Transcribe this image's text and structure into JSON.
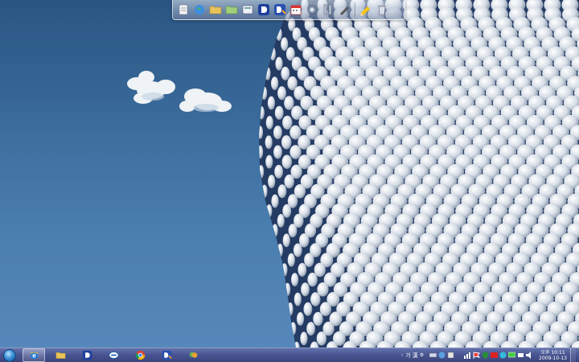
{
  "desktop": {
    "wallpaper": "selfridges-building-facade",
    "sky_color": "#3b6c9c",
    "disc_color": "#e8ecf2"
  },
  "dock": {
    "items": [
      {
        "icon": "notepad-icon"
      },
      {
        "icon": "globe-icon"
      },
      {
        "icon": "folder-icon"
      },
      {
        "icon": "folder-green-icon"
      },
      {
        "icon": "documents-icon"
      },
      {
        "icon": "d-app-icon"
      },
      {
        "icon": "d-app-edit-icon"
      },
      {
        "icon": "calendar-icon"
      },
      {
        "icon": "settings-icon"
      },
      {
        "icon": "tools-icon"
      },
      {
        "icon": "pen-icon"
      },
      {
        "icon": "pencil-icon"
      },
      {
        "icon": "recycle-bin-icon"
      }
    ]
  },
  "taskbar": {
    "buttons": [
      {
        "icon": "internet-explorer-icon",
        "active": true
      },
      {
        "icon": "folder-icon"
      },
      {
        "icon": "d-app-icon"
      },
      {
        "icon": "zoom-app-icon"
      },
      {
        "icon": "chrome-icon"
      },
      {
        "icon": "d-app-edit-icon"
      },
      {
        "icon": "messenger-icon"
      }
    ],
    "tray": {
      "ime_label": "가",
      "ime_label2": "漢",
      "clock_line1": "오후 10:11",
      "clock_line2": "2009-10-13"
    }
  }
}
